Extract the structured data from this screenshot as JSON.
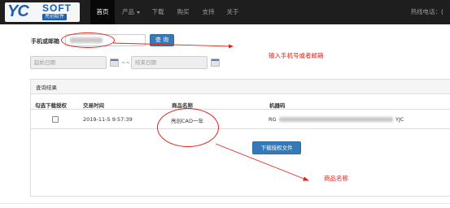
{
  "brand": {
    "logo_main": "YC",
    "logo_soft": "SOFT",
    "logo_sub": "亮创软件"
  },
  "nav": {
    "items": [
      {
        "label": "首页",
        "active": true
      },
      {
        "label": "产品",
        "dropdown": true
      },
      {
        "label": "下载"
      },
      {
        "label": "购买"
      },
      {
        "label": "支持"
      },
      {
        "label": "关于"
      }
    ],
    "hotline": "热线电话：("
  },
  "search": {
    "label": "手机或邮箱",
    "button": "查 询",
    "start_date_placeholder": "起始日期",
    "separator": "~~",
    "end_date_placeholder": "结束日期"
  },
  "results": {
    "panel_title": "查询结果",
    "columns": [
      "勾选下载授权",
      "交易时间",
      "商品名称",
      "机器码"
    ],
    "rows": [
      {
        "checked": false,
        "time": "2019-11-5 9:57:39",
        "product": "亮创CAD一年",
        "machine_prefix": "RG",
        "machine_suffix": "YJC"
      }
    ],
    "download_button": "下载授权文件"
  },
  "annotations": {
    "input_hint": "输入手机号或者邮箱",
    "product_hint": "商品名称",
    "color": "#e2231a"
  }
}
